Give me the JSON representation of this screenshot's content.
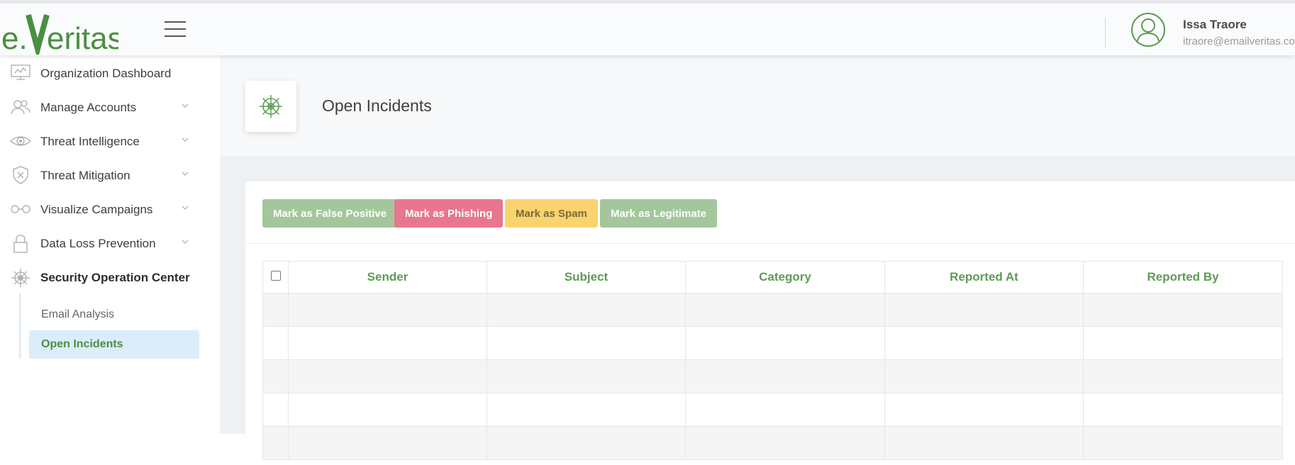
{
  "brand": {
    "logo_text": "e.Veritas",
    "accent": "#4b8f43"
  },
  "user": {
    "name": "Issa Traore",
    "email": "itraore@emailveritas.co"
  },
  "sidebar": {
    "items": [
      {
        "label": "Organization Dashboard",
        "icon": "presentation-board-icon"
      },
      {
        "label": "Manage Accounts",
        "icon": "users-icon"
      },
      {
        "label": "Threat Intelligence",
        "icon": "eye-icon"
      },
      {
        "label": "Threat Mitigation",
        "icon": "shield-x-icon"
      },
      {
        "label": "Visualize Campaigns",
        "icon": "glasses-icon"
      },
      {
        "label": "Data Loss Prevention",
        "icon": "lock-icon"
      },
      {
        "label": "Security Operation Center",
        "icon": "ship-wheel-icon"
      }
    ],
    "sub_items": [
      {
        "label": "Email Analysis"
      },
      {
        "label": "Open Incidents"
      }
    ]
  },
  "page": {
    "title": "Open Incidents"
  },
  "toolbar": {
    "buttons": [
      {
        "label": "Mark as False Positive",
        "color": "#a3c79b"
      },
      {
        "label": "Mark as Phishing",
        "color": "#e8768f"
      },
      {
        "label": "Mark as Spam",
        "color": "#f9d36e"
      },
      {
        "label": "Mark as Legitimate",
        "color": "#a3c79b"
      }
    ]
  },
  "table": {
    "columns": [
      "Sender",
      "Subject",
      "Category",
      "Reported At",
      "Reported By"
    ]
  }
}
